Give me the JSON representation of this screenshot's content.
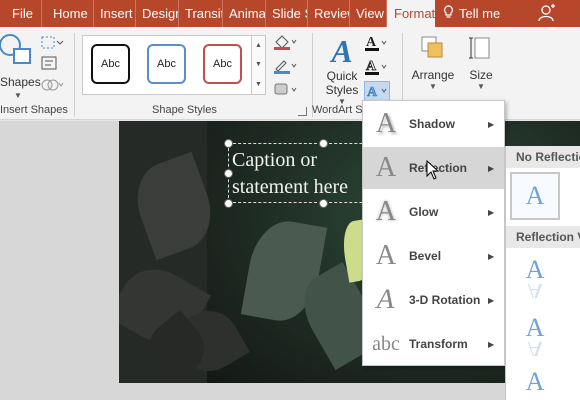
{
  "tabs": [
    {
      "label": "File"
    },
    {
      "label": "Home"
    },
    {
      "label": "Insert"
    },
    {
      "label": "Design"
    },
    {
      "label": "Transitions"
    },
    {
      "label": "Animations"
    },
    {
      "label": "Slide Show"
    },
    {
      "label": "Review"
    },
    {
      "label": "View"
    },
    {
      "label": "Format"
    },
    {
      "label": "Tell me"
    }
  ],
  "ribbon": {
    "insert_shapes": {
      "shapes_label": "Shapes",
      "group_label": "Insert Shapes"
    },
    "shape_styles": {
      "group_label": "Shape Styles",
      "presets": [
        {
          "label": "Abc",
          "border": "#111111"
        },
        {
          "label": "Abc",
          "border": "#5b8fc9"
        },
        {
          "label": "Abc",
          "border": "#c0504d"
        }
      ]
    },
    "wordart": {
      "quick_styles_label": "Quick Styles",
      "group_label": "WordArt Styles"
    },
    "arrange": {
      "label": "Arrange"
    },
    "size": {
      "label": "Size"
    }
  },
  "slide": {
    "caption": "Caption or statement here",
    "caption_line1": "Caption or",
    "caption_line2": "statement here"
  },
  "text_effects_menu": {
    "items": [
      {
        "label": "Shadow",
        "icon": "text-shadow-icon"
      },
      {
        "label": "Reflection",
        "icon": "text-reflection-icon",
        "highlighted": true
      },
      {
        "label": "Glow",
        "icon": "text-glow-icon"
      },
      {
        "label": "Bevel",
        "icon": "text-bevel-icon"
      },
      {
        "label": "3-D Rotation",
        "icon": "text-3d-rotation-icon"
      },
      {
        "label": "Transform",
        "icon": "text-transform-icon",
        "icon_text": "abc"
      }
    ]
  },
  "reflection_submenu": {
    "no_reflection_header": "No Reflection",
    "variations_header": "Reflection Variations",
    "glyph": "A"
  },
  "colors": {
    "accent": "#b7472a",
    "ribbon_bg": "#f3f3f3",
    "menu_highlight": "#d6d6d6",
    "reflection_blue": "#6fa3d8"
  }
}
